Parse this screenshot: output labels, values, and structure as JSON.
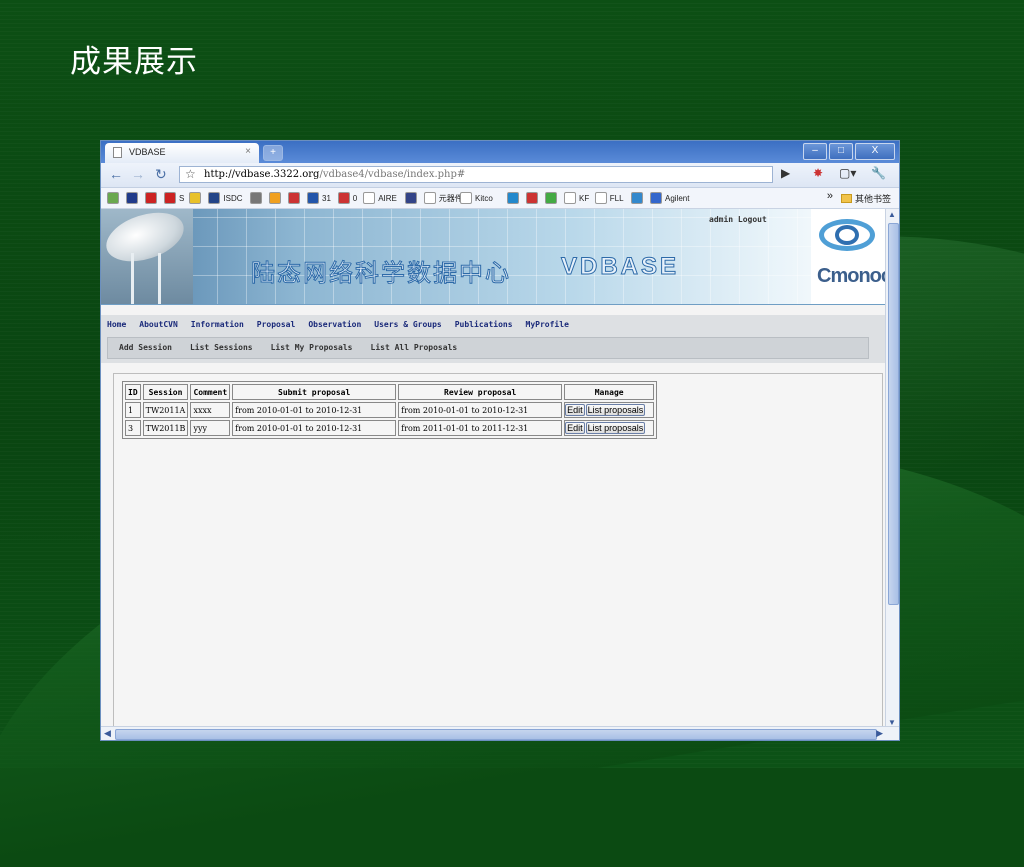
{
  "slide": {
    "title": "成果展示"
  },
  "browser": {
    "tab_title": "VDBASE",
    "tab_close": "×",
    "new_tab": "+",
    "url_host": "http://vdbase.3322.org",
    "url_path": "/vdbase4/vdbase/index.php#",
    "window_buttons": {
      "minimize": "–",
      "maximize": "□",
      "close": "X"
    }
  },
  "bookmarks": [
    {
      "label": "",
      "color": "#6aa84f"
    },
    {
      "label": "",
      "color": "#1f3a8a"
    },
    {
      "label": "",
      "color": "#cc2222"
    },
    {
      "label": "S",
      "color": "#cc2222"
    },
    {
      "label": "",
      "color": "#e8c12a"
    },
    {
      "label": "ISDC",
      "color": "#224488"
    },
    {
      "label": "",
      "color": "#777777"
    },
    {
      "label": "",
      "color": "#f0a020"
    },
    {
      "label": "",
      "color": "#cc3333"
    },
    {
      "label": "31",
      "color": "#2255aa"
    },
    {
      "label": "0",
      "color": "#cc3333"
    },
    {
      "label": "AIRE",
      "color": "#ffffff"
    },
    {
      "label": "",
      "color": "#334488"
    },
    {
      "label": "元器件",
      "color": "#ffffff"
    },
    {
      "label": "Kitco",
      "color": "#ffffff"
    },
    {
      "label": "",
      "color": "#2288cc"
    },
    {
      "label": "",
      "color": "#cc3333"
    },
    {
      "label": "",
      "color": "#44aa44"
    },
    {
      "label": "KF",
      "color": "#ffffff"
    },
    {
      "label": "FLL",
      "color": "#ffffff"
    },
    {
      "label": "",
      "color": "#3388cc"
    },
    {
      "label": "Agilent",
      "color": "#3366cc"
    }
  ],
  "bookmarks_more": "»",
  "bookmarks_folder": "其他书签",
  "site": {
    "banner_title": "陆态网络科学数据中心",
    "banner_brand": "VDBASE",
    "user_links": "admin Logout",
    "logo_text": "Cmonoc",
    "main_menu": [
      "Home",
      "AboutCVN",
      "Information",
      "Proposal",
      "Observation",
      "Users & Groups",
      "Publications",
      "MyProfile"
    ],
    "sub_menu": [
      "Add Session",
      "List Sessions",
      "List My Proposals",
      "List All Proposals"
    ]
  },
  "table": {
    "headers": [
      "ID",
      "Session",
      "Comment",
      "Submit proposal",
      "Review proposal",
      "Manage"
    ],
    "rows": [
      {
        "id": "1",
        "session": "TW2011A",
        "comment": "xxxx",
        "submit": "from 2010-01-01 to 2010-12-31",
        "review": "from 2010-01-01 to 2010-12-31",
        "edit": "Edit",
        "list": "List proposals"
      },
      {
        "id": "3",
        "session": "TW2011B",
        "comment": "yyy",
        "submit": "from 2010-01-01 to 2010-12-31",
        "review": "from 2011-01-01 to 2011-12-31",
        "edit": "Edit",
        "list": "List proposals"
      }
    ]
  }
}
